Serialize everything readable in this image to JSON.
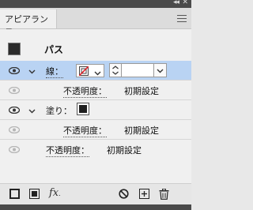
{
  "window": {
    "collapse_glyph": "◂◂",
    "close_glyph": "✕"
  },
  "panel": {
    "tab_title": "アピアランス"
  },
  "header": {
    "title": "パス"
  },
  "stroke": {
    "label": "線："
  },
  "stroke_opacity": {
    "label": "不透明度：",
    "value": "初期設定"
  },
  "fill": {
    "label": "塗り："
  },
  "fill_opacity": {
    "label": "不透明度：",
    "value": "初期設定"
  },
  "object_opacity": {
    "label": "不透明度：",
    "value": "初期設定"
  },
  "icons": {
    "visibility": "eye-icon",
    "disclosure": "chevron-down-icon",
    "add_stroke": "add-new-stroke-icon",
    "add_fill": "add-new-fill-icon",
    "effects": "fx-icon",
    "clear": "clear-appearance-icon",
    "duplicate": "duplicate-item-icon",
    "delete": "trash-icon",
    "menu": "panel-menu-icon"
  },
  "bottom_bar": {
    "fx_label": "fx",
    "fx_suffix": "."
  },
  "colors": {
    "selected_row": "#b9d3f3",
    "none_swatch_slash": "#e0242b",
    "panel_bg": "#f0f0f0"
  }
}
